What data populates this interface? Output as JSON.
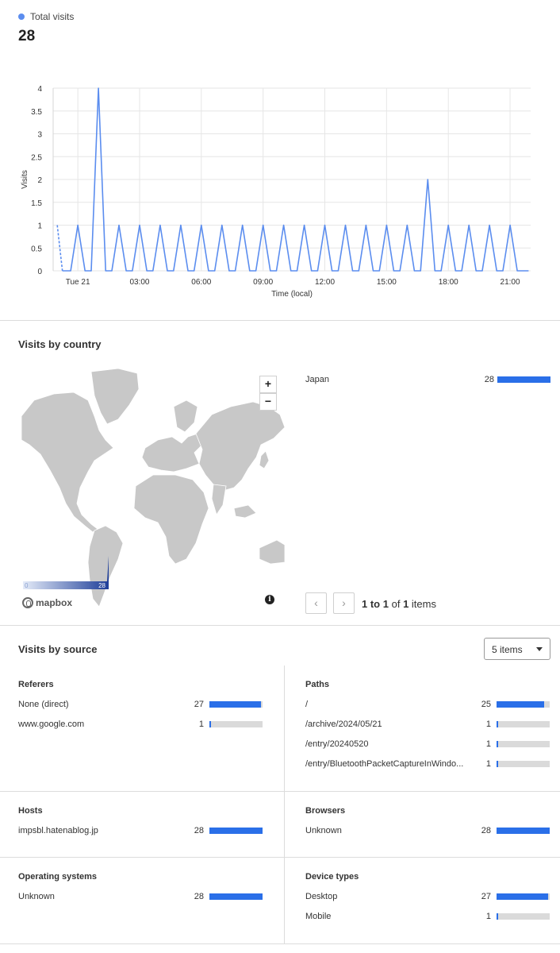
{
  "total_visits": {
    "legend_label": "Total visits",
    "value": "28",
    "series_color": "#5b8def"
  },
  "chart_data": {
    "type": "line",
    "ylabel": "Visits",
    "xlabel": "Time (local)",
    "ylim": [
      0,
      4
    ],
    "y_ticks": [
      "0",
      "0.5",
      "1",
      "1.5",
      "2",
      "2.5",
      "3",
      "3.5",
      "4"
    ],
    "x_tick_labels": [
      "Tue 21",
      "03:00",
      "06:00",
      "09:00",
      "12:00",
      "15:00",
      "18:00",
      "21:00"
    ],
    "x_tick_hours": [
      0,
      3,
      6,
      9,
      12,
      15,
      18,
      21
    ],
    "xlim_hours": [
      -1.2,
      22
    ],
    "grid": true,
    "series": [
      {
        "hours": [
          -1,
          0,
          1,
          2,
          3,
          4,
          5,
          6,
          7,
          8,
          9,
          10,
          11,
          12,
          13,
          14,
          15,
          16,
          17,
          18,
          19,
          20,
          21
        ],
        "values": [
          1,
          1,
          4,
          1,
          1,
          1,
          1,
          1,
          1,
          1,
          1,
          1,
          1,
          1,
          1,
          1,
          1,
          1,
          2,
          1,
          1,
          1,
          1
        ]
      }
    ],
    "dashed_start_value": 1
  },
  "visits_by_country": {
    "title": "Visits by country",
    "countries": [
      {
        "name": "Japan",
        "count": "28",
        "fraction": 1.0
      }
    ],
    "map_legend_min": "0",
    "map_legend_max": "28",
    "zoom_in": "+",
    "zoom_out": "−",
    "info_icon": "i",
    "attribution": "mapbox",
    "pager": {
      "prev": "‹",
      "next": "›",
      "range": "1 to 1",
      "of": "of",
      "total": "1",
      "items": "items"
    }
  },
  "visits_by_source": {
    "title": "Visits by source",
    "items_select": "5 items",
    "referers": {
      "title": "Referers",
      "rows": [
        {
          "label": "None (direct)",
          "count": "27",
          "fraction": 0.964
        },
        {
          "label": "www.google.com",
          "count": "1",
          "fraction": 0.036
        }
      ]
    },
    "paths": {
      "title": "Paths",
      "rows": [
        {
          "label": "/",
          "count": "25",
          "fraction": 0.893
        },
        {
          "label": "/archive/2024/05/21",
          "count": "1",
          "fraction": 0.036
        },
        {
          "label": "/entry/20240520",
          "count": "1",
          "fraction": 0.036
        },
        {
          "label": "/entry/BluetoothPacketCaptureInWindo...",
          "count": "1",
          "fraction": 0.036
        }
      ]
    },
    "hosts": {
      "title": "Hosts",
      "rows": [
        {
          "label": "impsbl.hatenablog.jp",
          "count": "28",
          "fraction": 1.0
        }
      ]
    },
    "browsers": {
      "title": "Browsers",
      "rows": [
        {
          "label": "Unknown",
          "count": "28",
          "fraction": 1.0
        }
      ]
    },
    "operating_systems": {
      "title": "Operating systems",
      "rows": [
        {
          "label": "Unknown",
          "count": "28",
          "fraction": 1.0
        }
      ]
    },
    "device_types": {
      "title": "Device types",
      "rows": [
        {
          "label": "Desktop",
          "count": "27",
          "fraction": 0.964
        },
        {
          "label": "Mobile",
          "count": "1",
          "fraction": 0.036
        }
      ]
    }
  },
  "colors": {
    "bar_fill": "#2a6fe8",
    "bar_track": "#dadada",
    "map_land": "#c8c8c8"
  }
}
